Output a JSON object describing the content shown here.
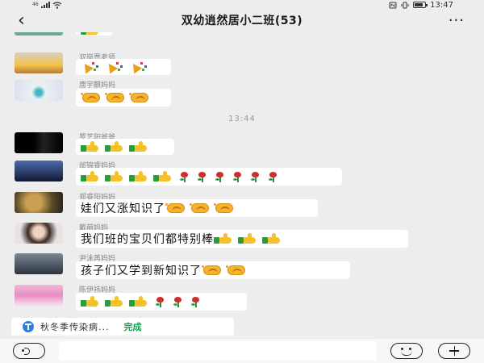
{
  "status_bar": {
    "network": "46",
    "time": "13:47",
    "battery_level": 0.85
  },
  "header": {
    "back_icon": "chevron-left-icon",
    "title": "双幼逍然居小二班(53)",
    "more_icon": "more-icon"
  },
  "chat": {
    "timestamp": "13:44",
    "messages": [
      {
        "sender": "",
        "text": "",
        "emojis": [
          "thumbs-up"
        ]
      },
      {
        "sender": "双岗贾老师",
        "text": "",
        "emojis": [
          "party-popper",
          "party-popper",
          "party-popper"
        ]
      },
      {
        "sender": "唐宇麒妈妈",
        "text": "",
        "emojis": [
          "fist-bump",
          "fist-bump",
          "fist-bump"
        ]
      },
      {
        "sender": "罗艺阳爸爸",
        "text": "",
        "emojis": [
          "thumbs-up",
          "thumbs-up",
          "thumbs-up"
        ]
      },
      {
        "sender": "邰锦睿妈妈",
        "text": "",
        "emojis": [
          "thumbs-up",
          "thumbs-up",
          "thumbs-up",
          "thumbs-up",
          "rose",
          "rose",
          "rose",
          "rose",
          "rose",
          "rose"
        ]
      },
      {
        "sender": "郑睿阳妈妈",
        "text": "娃们又涨知识了",
        "emojis": [
          "fist-bump",
          "fist-bump",
          "fist-bump"
        ]
      },
      {
        "sender": "戴萌妈妈",
        "text": "我们班的宝贝们都特别棒",
        "emojis": [
          "thumbs-up",
          "thumbs-up",
          "thumbs-up"
        ]
      },
      {
        "sender": "尹沫苒妈妈",
        "text": "孩子们又学到新知识了",
        "emojis": [
          "fist-bump",
          "fist-bump"
        ]
      },
      {
        "sender": "陈伊祎妈妈",
        "text": "",
        "emojis": [
          "thumbs-up",
          "thumbs-up",
          "thumbs-up",
          "rose",
          "rose",
          "rose"
        ]
      }
    ]
  },
  "notice": {
    "icon": "file-transfer-icon",
    "text": "秋冬季传染病...",
    "status": "完成"
  },
  "input_bar": {
    "voice_icon": "voice-icon",
    "text_value": "",
    "emoji_icon": "emoji-icon",
    "plus_icon": "plus-icon"
  },
  "colors": {
    "background": "#ededed",
    "bubble": "#ffffff",
    "done_green": "#07a64a",
    "notice_blue": "#2f7fe0"
  }
}
